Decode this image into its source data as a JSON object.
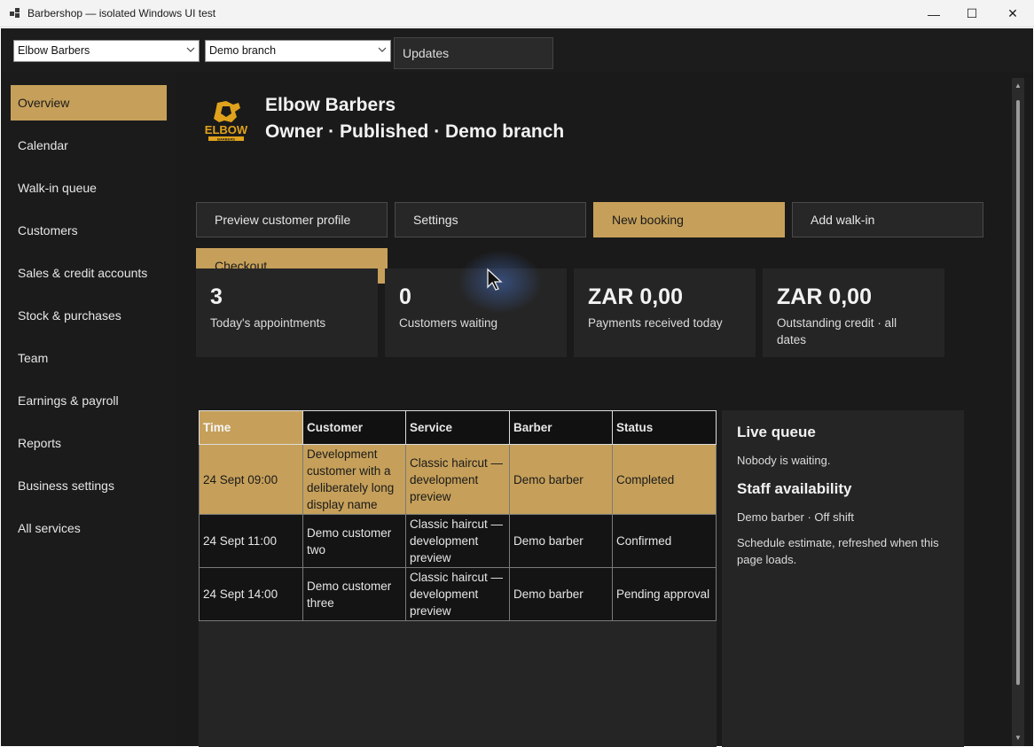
{
  "window": {
    "title": "Barbershop — isolated Windows UI test",
    "minimize": "—",
    "maximize": "☐",
    "close": "✕"
  },
  "toolbar": {
    "business_select": "Elbow Barbers",
    "branch_select": "Demo branch",
    "updates_label": "Updates"
  },
  "sidebar": {
    "items": [
      {
        "label": "Overview",
        "active": true
      },
      {
        "label": "Calendar"
      },
      {
        "label": "Walk-in queue"
      },
      {
        "label": "Customers"
      },
      {
        "label": "Sales & credit accounts"
      },
      {
        "label": "Stock & purchases"
      },
      {
        "label": "Team"
      },
      {
        "label": "Earnings & payroll"
      },
      {
        "label": "Reports"
      },
      {
        "label": "Business settings"
      },
      {
        "label": "All services"
      }
    ]
  },
  "header": {
    "logo_text": "ELBOW",
    "logo_subtext": "BARBERS",
    "business_name": "Elbow Barbers",
    "subtitle": "Owner · Published · Demo branch"
  },
  "actions": {
    "preview": "Preview customer profile",
    "settings": "Settings",
    "new_booking": "New booking",
    "add_walkin": "Add walk-in",
    "checkout": "Checkout"
  },
  "stats": [
    {
      "value": "3",
      "label": "Today's appointments"
    },
    {
      "value": "0",
      "label": "Customers waiting"
    },
    {
      "value": "ZAR 0,00",
      "label": "Payments received today"
    },
    {
      "value": "ZAR 0,00",
      "label": "Outstanding credit · all dates"
    }
  ],
  "table": {
    "headers": [
      "Time",
      "Customer",
      "Service",
      "Barber",
      "Status"
    ],
    "rows": [
      {
        "time": "24 Sept 09:00",
        "customer": "Development customer with a deliberately long display name",
        "service": "Classic haircut — development preview",
        "barber": "Demo barber",
        "status": "Completed",
        "selected": true
      },
      {
        "time": "24 Sept 11:00",
        "customer": "Demo customer two",
        "service": "Classic haircut — development preview",
        "barber": "Demo barber",
        "status": "Confirmed"
      },
      {
        "time": "24 Sept 14:00",
        "customer": "Demo customer three",
        "service": "Classic haircut — development preview",
        "barber": "Demo barber",
        "status": "Pending approval"
      }
    ]
  },
  "live_queue": {
    "title": "Live queue",
    "text": "Nobody is waiting."
  },
  "staff": {
    "title": "Staff availability",
    "status": "Demo barber · Off shift",
    "note": "Schedule estimate, refreshed when this page loads."
  },
  "colors": {
    "accent": "#c6a05a",
    "background": "#1a1a1a",
    "panel": "#252525"
  }
}
